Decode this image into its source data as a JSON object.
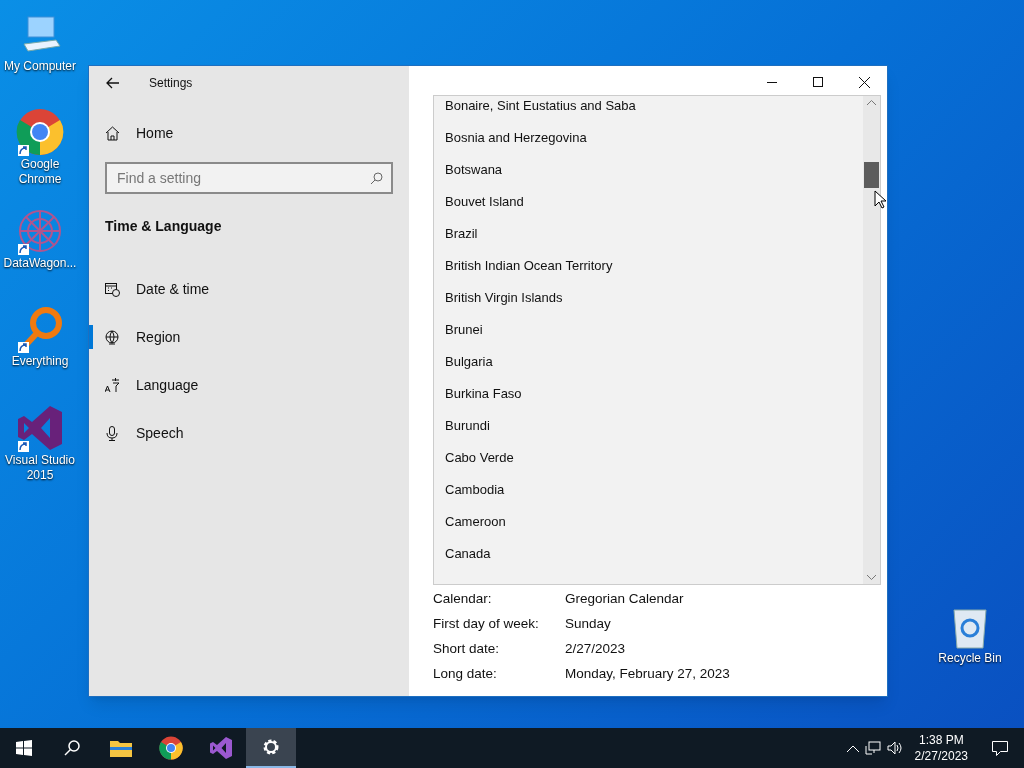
{
  "desktop_icons": [
    {
      "kind": "computer",
      "label": "My Computer",
      "shortcut": false
    },
    {
      "kind": "chrome",
      "label": "Google Chrome",
      "shortcut": true
    },
    {
      "kind": "datawagon",
      "label": "DataWagon...",
      "shortcut": true
    },
    {
      "kind": "everything",
      "label": "Everything",
      "shortcut": true
    },
    {
      "kind": "vs",
      "label": "Visual Studio 2015",
      "shortcut": true
    },
    {
      "kind": "recycle",
      "label": "Recycle Bin",
      "shortcut": false
    }
  ],
  "window": {
    "title": "Settings"
  },
  "sidebar": {
    "home": "Home",
    "search": {
      "placeholder": "Find a setting"
    },
    "section": "Time & Language",
    "items": [
      {
        "kind": "calendar",
        "label": "Date & time",
        "selected": false
      },
      {
        "kind": "globe",
        "label": "Region",
        "selected": true
      },
      {
        "kind": "language",
        "label": "Language",
        "selected": false
      },
      {
        "kind": "mic",
        "label": "Speech",
        "selected": false
      }
    ]
  },
  "country_list": [
    "Bonaire, Sint Eustatius and Saba",
    "Bosnia and Herzegovina",
    "Botswana",
    "Bouvet Island",
    "Brazil",
    "British Indian Ocean Territory",
    "British Virgin Islands",
    "Brunei",
    "Bulgaria",
    "Burkina Faso",
    "Burundi",
    "Cabo Verde",
    "Cambodia",
    "Cameroon",
    "Canada"
  ],
  "format_rows": [
    {
      "label": "Calendar:",
      "value": "Gregorian Calendar"
    },
    {
      "label": "First day of week:",
      "value": "Sunday"
    },
    {
      "label": "Short date:",
      "value": "2/27/2023"
    },
    {
      "label": "Long date:",
      "value": "Monday, February 27, 2023"
    }
  ],
  "taskbar": {
    "apps": [
      {
        "kind": "explorer",
        "active": false
      },
      {
        "kind": "chrome",
        "active": false
      },
      {
        "kind": "vs",
        "active": false
      },
      {
        "kind": "settings",
        "active": true
      }
    ],
    "time": "1:38 PM",
    "date": "2/27/2023"
  }
}
